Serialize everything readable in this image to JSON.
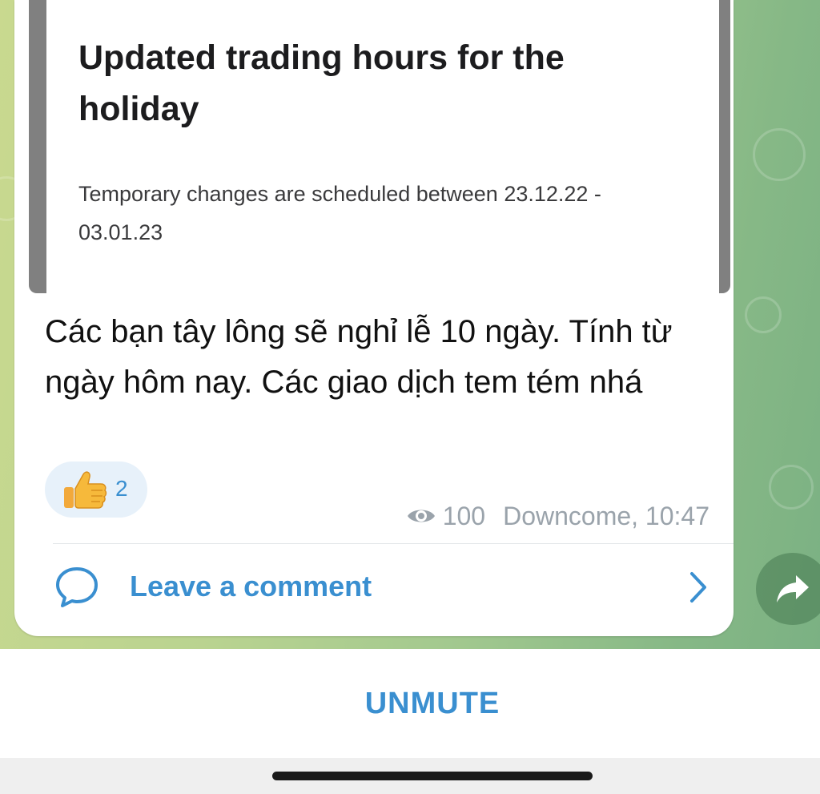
{
  "link_preview": {
    "title": "Updated trading hours for the holiday",
    "description": "Temporary changes are scheduled between 23.12.22 - 03.01.23"
  },
  "message": {
    "text": "Các bạn tây lông sẽ nghỉ lễ 10 ngày. Tính từ ngày hôm nay. Các giao dịch tem tém nhá"
  },
  "reaction": {
    "emoji_icon": "thumbs-up-icon",
    "count": "2"
  },
  "meta": {
    "views": "100",
    "author_time": "Downcome, 10:47"
  },
  "comments": {
    "label": "Leave a comment"
  },
  "bottom_bar": {
    "unmute_label": "UNMUTE"
  },
  "colors": {
    "accent": "#3a8fd0",
    "bubble": "#ffffff",
    "preview_border": "#808080"
  }
}
